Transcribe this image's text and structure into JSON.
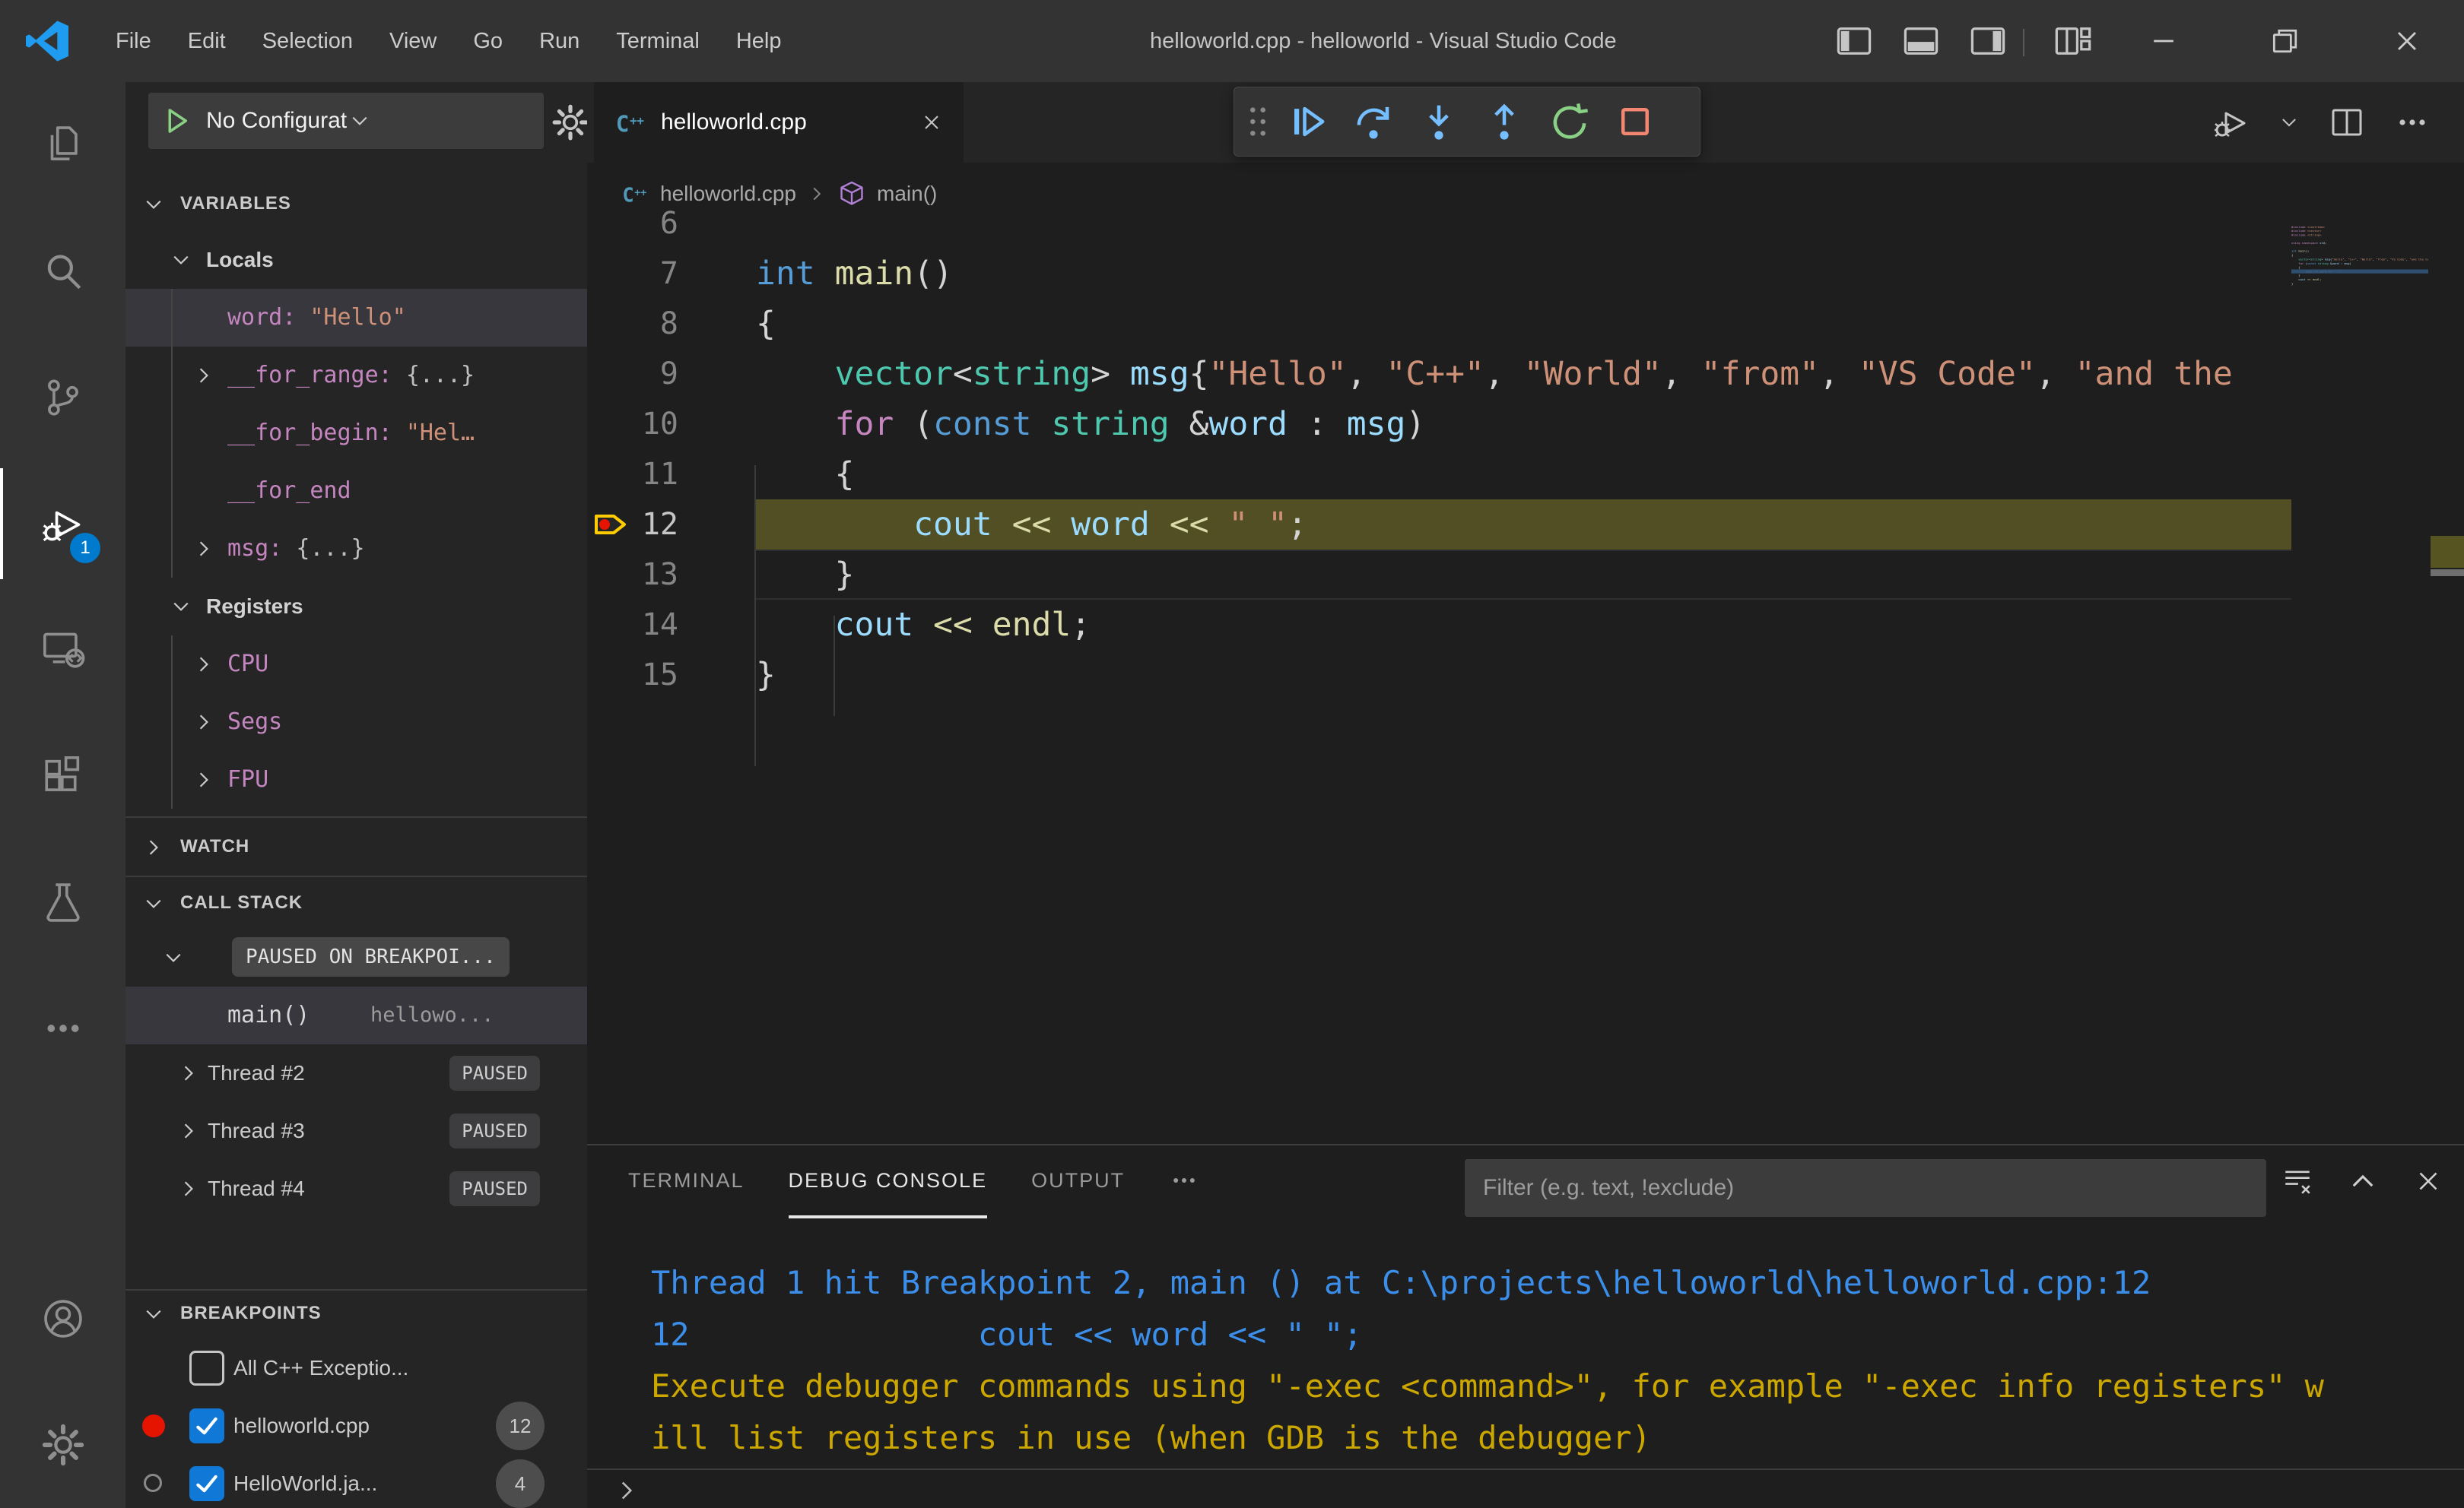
{
  "window": {
    "title": "helloworld.cpp - helloworld - Visual Studio Code",
    "menus": [
      "File",
      "Edit",
      "Selection",
      "View",
      "Go",
      "Run",
      "Terminal",
      "Help"
    ]
  },
  "activity_bar": {
    "items": [
      {
        "name": "explorer",
        "icon": "files-icon"
      },
      {
        "name": "search",
        "icon": "search-icon"
      },
      {
        "name": "source-control",
        "icon": "source-control-icon"
      },
      {
        "name": "run-and-debug",
        "icon": "run-debug-icon",
        "active": true,
        "badge": "1"
      },
      {
        "name": "remote-explorer",
        "icon": "remote-explorer-icon"
      },
      {
        "name": "extensions",
        "icon": "extensions-icon"
      },
      {
        "name": "testing",
        "icon": "testing-icon"
      },
      {
        "name": "additional-views",
        "icon": "more-icon"
      }
    ],
    "bottom_items": [
      {
        "name": "accounts",
        "icon": "account-icon"
      },
      {
        "name": "manage",
        "icon": "settings-gear-icon"
      }
    ]
  },
  "sidebar": {
    "debug_toolbar": {
      "config_label": "No Configurat"
    },
    "variables": {
      "header": "VARIABLES",
      "items": [
        {
          "kind": "scope",
          "label": "Locals",
          "chevron": "down"
        },
        {
          "kind": "var",
          "name": "word: ",
          "value": "\"Hello\"",
          "vtype": "str",
          "selected": true
        },
        {
          "kind": "var",
          "name": "__for_range: ",
          "value": "{...}",
          "vtype": "obj",
          "chevron": "right"
        },
        {
          "kind": "var",
          "name": "__for_begin: ",
          "value": "\"Hel…",
          "vtype": "str"
        },
        {
          "kind": "var",
          "name": "__for_end",
          "value": "",
          "vtype": "obj"
        },
        {
          "kind": "var",
          "name": "msg: ",
          "value": "{...}",
          "vtype": "obj",
          "chevron": "right"
        },
        {
          "kind": "scope",
          "label": "Registers",
          "chevron": "down"
        },
        {
          "kind": "var",
          "name": "CPU",
          "value": "",
          "vtype": "obj",
          "chevron": "right"
        },
        {
          "kind": "var",
          "name": "Segs",
          "value": "",
          "vtype": "obj",
          "chevron": "right"
        },
        {
          "kind": "var",
          "name": "FPU",
          "value": "",
          "vtype": "obj",
          "chevron": "right"
        }
      ]
    },
    "watch": {
      "header": "WATCH"
    },
    "call_stack": {
      "header": "CALL STACK",
      "status_pill": "PAUSED ON BREAKPOI...",
      "frames": [
        {
          "fn": "main()",
          "file": "hellowo...",
          "selected": true
        }
      ],
      "threads": [
        {
          "label": "Thread #2",
          "badge": "PAUSED"
        },
        {
          "label": "Thread #3",
          "badge": "PAUSED"
        },
        {
          "label": "Thread #4",
          "badge": "PAUSED"
        }
      ]
    },
    "breakpoints": {
      "header": "BREAKPOINTS",
      "items": [
        {
          "label": "All C++ Exceptio...",
          "checked": false,
          "marker": "none"
        },
        {
          "label": "helloworld.cpp",
          "checked": true,
          "marker": "red-dot",
          "count": "12"
        },
        {
          "label": "HelloWorld.ja...",
          "checked": true,
          "marker": "gray-circle",
          "count": "4"
        }
      ]
    }
  },
  "editor": {
    "tab": {
      "label": "helloworld.cpp"
    },
    "breadcrumbs": [
      {
        "icon": "cpp-file-icon",
        "label": "helloworld.cpp"
      },
      {
        "icon": "symbol-method-icon",
        "label": "main()"
      }
    ],
    "debug_toolbar_buttons": [
      "continue",
      "step-over",
      "step-into",
      "step-out",
      "restart",
      "stop"
    ],
    "active_line": 12,
    "breakpoint_line": 12,
    "cursor_line": 13,
    "code_lines": [
      {
        "n": 6,
        "tokens": []
      },
      {
        "n": 7,
        "tokens": [
          [
            "k",
            "int"
          ],
          [
            "pl",
            " "
          ],
          [
            "fn",
            "main"
          ],
          [
            "pl",
            "()"
          ]
        ]
      },
      {
        "n": 8,
        "tokens": [
          [
            "pl",
            "{"
          ]
        ]
      },
      {
        "n": 9,
        "tokens": [
          [
            "pl",
            "    "
          ],
          [
            "ty",
            "vector"
          ],
          [
            "pl",
            "<"
          ],
          [
            "ty",
            "string"
          ],
          [
            "pl",
            "> "
          ],
          [
            "v",
            "msg"
          ],
          [
            "pl",
            "{"
          ],
          [
            "s",
            "\"Hello\""
          ],
          [
            "pl",
            ", "
          ],
          [
            "s",
            "\"C++\""
          ],
          [
            "pl",
            ", "
          ],
          [
            "s",
            "\"World\""
          ],
          [
            "pl",
            ", "
          ],
          [
            "s",
            "\"from\""
          ],
          [
            "pl",
            ", "
          ],
          [
            "s",
            "\"VS Code\""
          ],
          [
            "pl",
            ", "
          ],
          [
            "s",
            "\"and the"
          ]
        ]
      },
      {
        "n": 10,
        "tokens": [
          [
            "pl",
            "    "
          ],
          [
            "kc",
            "for"
          ],
          [
            "pl",
            " ("
          ],
          [
            "k",
            "const"
          ],
          [
            "pl",
            " "
          ],
          [
            "ty",
            "string"
          ],
          [
            "pl",
            " &"
          ],
          [
            "v",
            "word"
          ],
          [
            "pl",
            " : "
          ],
          [
            "v",
            "msg"
          ],
          [
            "pl",
            ")"
          ]
        ]
      },
      {
        "n": 11,
        "tokens": [
          [
            "pl",
            "    {"
          ]
        ]
      },
      {
        "n": 12,
        "tokens": [
          [
            "pl",
            "        "
          ],
          [
            "v",
            "cout"
          ],
          [
            "pl",
            " "
          ],
          [
            "fn",
            "<<"
          ],
          [
            "pl",
            " "
          ],
          [
            "v",
            "word"
          ],
          [
            "pl",
            " "
          ],
          [
            "fn",
            "<<"
          ],
          [
            "pl",
            " "
          ],
          [
            "s",
            "\" \""
          ],
          [
            "pl",
            ";"
          ]
        ]
      },
      {
        "n": 13,
        "tokens": [
          [
            "pl",
            "    }"
          ]
        ]
      },
      {
        "n": 14,
        "tokens": [
          [
            "pl",
            "    "
          ],
          [
            "v",
            "cout"
          ],
          [
            "pl",
            " "
          ],
          [
            "fn",
            "<<"
          ],
          [
            "pl",
            " "
          ],
          [
            "fn",
            "endl"
          ],
          [
            "pl",
            ";"
          ]
        ]
      },
      {
        "n": 15,
        "tokens": [
          [
            "pl",
            "}"
          ]
        ]
      }
    ],
    "minimap_lines": [
      [
        [
          "kc",
          "#include"
        ],
        [
          "pl",
          " "
        ],
        [
          "s",
          "<iostream>"
        ]
      ],
      [
        [
          "kc",
          "#include"
        ],
        [
          "pl",
          " "
        ],
        [
          "s",
          "<vector>"
        ]
      ],
      [
        [
          "kc",
          "#include"
        ],
        [
          "pl",
          " "
        ],
        [
          "s",
          "<string>"
        ]
      ],
      [],
      [
        [
          "kc",
          "using"
        ],
        [
          "pl",
          " "
        ],
        [
          "kc",
          "namespace"
        ],
        [
          "pl",
          " "
        ],
        [
          "v",
          "std"
        ],
        [
          "pl",
          ";"
        ]
      ],
      [],
      [
        [
          "k",
          "int"
        ],
        [
          "pl",
          " "
        ],
        [
          "fn",
          "main"
        ],
        [
          "pl",
          "()"
        ]
      ],
      [
        [
          "pl",
          "{"
        ]
      ],
      [
        [
          "pl",
          "    "
        ],
        [
          "ty",
          "vector"
        ],
        [
          "pl",
          "<"
        ],
        [
          "ty",
          "string"
        ],
        [
          "pl",
          "> "
        ],
        [
          "v",
          "msg"
        ],
        [
          "pl",
          "{"
        ],
        [
          "s",
          "\"Hello\""
        ],
        [
          "pl",
          ", "
        ],
        [
          "s",
          "\"C++\""
        ],
        [
          "pl",
          ", "
        ],
        [
          "s",
          "\"World\""
        ],
        [
          "pl",
          ", "
        ],
        [
          "s",
          "\"from\""
        ],
        [
          "pl",
          ", "
        ],
        [
          "s",
          "\"VS Code\""
        ],
        [
          "pl",
          ", "
        ],
        [
          "s",
          "\"and the C++ extension!\""
        ],
        [
          "pl",
          "};"
        ]
      ],
      [
        [
          "pl",
          "    "
        ],
        [
          "kc",
          "for"
        ],
        [
          "pl",
          " ("
        ],
        [
          "k",
          "const"
        ],
        [
          "pl",
          " "
        ],
        [
          "ty",
          "string"
        ],
        [
          "pl",
          " &"
        ],
        [
          "v",
          "word"
        ],
        [
          "pl",
          " : "
        ],
        [
          "v",
          "msg"
        ],
        [
          "pl",
          ")"
        ]
      ],
      [
        [
          "pl",
          "    {"
        ]
      ],
      [
        [
          "pl",
          "        "
        ],
        [
          "v",
          "cout"
        ],
        [
          "pl",
          " "
        ],
        [
          "fn",
          "<<"
        ],
        [
          "pl",
          " "
        ],
        [
          "v",
          "word"
        ],
        [
          "pl",
          " "
        ],
        [
          "fn",
          "<<"
        ],
        [
          "pl",
          " "
        ],
        [
          "s",
          "\" \""
        ],
        [
          "pl",
          ";"
        ]
      ],
      [
        [
          "pl",
          "    }"
        ]
      ],
      [
        [
          "pl",
          "    "
        ],
        [
          "v",
          "cout"
        ],
        [
          "pl",
          " "
        ],
        [
          "fn",
          "<<"
        ],
        [
          "pl",
          " "
        ],
        [
          "fn",
          "endl"
        ],
        [
          "pl",
          ";"
        ]
      ],
      [
        [
          "pl",
          "}"
        ]
      ]
    ]
  },
  "panel": {
    "tabs": [
      {
        "label": "TERMINAL"
      },
      {
        "label": "DEBUG CONSOLE",
        "active": true
      },
      {
        "label": "OUTPUT"
      },
      {
        "icon": "ellipsis-icon",
        "name": "more-panel-views"
      }
    ],
    "filter_placeholder": "Filter (e.g. text, !exclude)",
    "console_lines": [
      {
        "kind": "info",
        "text": "Thread 1 hit Breakpoint 2, main () at C:\\projects\\helloworld\\helloworld.cpp:12"
      },
      {
        "kind": "info",
        "text": "12               cout << word << \" \";"
      },
      {
        "kind": "warn",
        "text": "Execute debugger commands using \"-exec <command>\", for example \"-exec info registers\" w"
      },
      {
        "kind": "warn",
        "text": "ill list registers in use (when GDB is the debugger)"
      }
    ]
  },
  "colors": {
    "accent": "#007acc",
    "console_info": "#3b8eea",
    "console_warn": "#cca700",
    "breakpoint_red": "#e51400",
    "paused_line_bg": "#514f23",
    "variable_name": "#c586c0",
    "variable_string_value": "#ce9178",
    "tokens": {
      "k": "#569cd6",
      "kc": "#c586c0",
      "ty": "#4ec9b0",
      "v": "#9cdcfe",
      "s": "#ce9178",
      "fn": "#dcdcaa",
      "pl": "#d4d4d4"
    }
  }
}
